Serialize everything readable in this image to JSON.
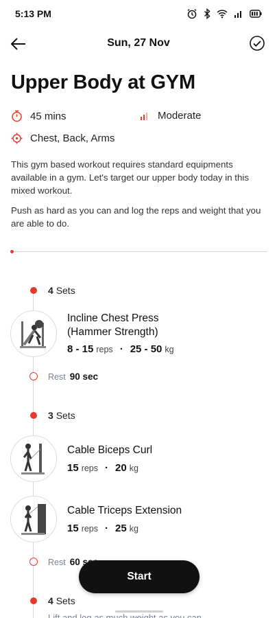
{
  "status_bar": {
    "time": "5:13 PM",
    "icons": [
      "alarm-icon",
      "bluetooth-icon",
      "wifi-icon",
      "signal-icon",
      "battery-icon"
    ]
  },
  "app_bar": {
    "back_icon": "arrow-left-icon",
    "date": "Sun, 27 Nov",
    "done_icon": "check-circle-icon"
  },
  "workout": {
    "title": "Upper Body at GYM",
    "duration": "45 mins",
    "intensity": "Moderate",
    "muscles": "Chest, Back, Arms",
    "description": [
      "This gym based workout requires standard equipments available in a gym. Let's target our upper body today in this mixed workout.",
      "Push as hard as you can and log the reps and weight that you are able to do."
    ]
  },
  "groups": [
    {
      "sets": "4",
      "sets_label": "Sets",
      "exercises": [
        {
          "name_line1": "Incline Chest Press",
          "name_line2": "(Hammer Strength)",
          "reps": "8 - 15",
          "reps_unit": "reps",
          "weight": "25 - 50",
          "weight_unit": "kg"
        }
      ],
      "rest_label": "Rest",
      "rest_value": "90 sec"
    },
    {
      "sets": "3",
      "sets_label": "Sets",
      "exercises": [
        {
          "name_line1": "Cable Biceps Curl",
          "reps": "15",
          "reps_unit": "reps",
          "weight": "20",
          "weight_unit": "kg"
        },
        {
          "name_line1": "Cable Triceps Extension",
          "reps": "15",
          "reps_unit": "reps",
          "weight": "25",
          "weight_unit": "kg"
        }
      ],
      "rest_label": "Rest",
      "rest_value": "60 sec"
    },
    {
      "sets": "4",
      "sets_label": "Sets",
      "note": "Lift and log as much weight as you can"
    }
  ],
  "start_button": "Start",
  "colors": {
    "accent": "#e53b2c",
    "button_bg": "#111111",
    "muted_text": "#7a8196"
  }
}
